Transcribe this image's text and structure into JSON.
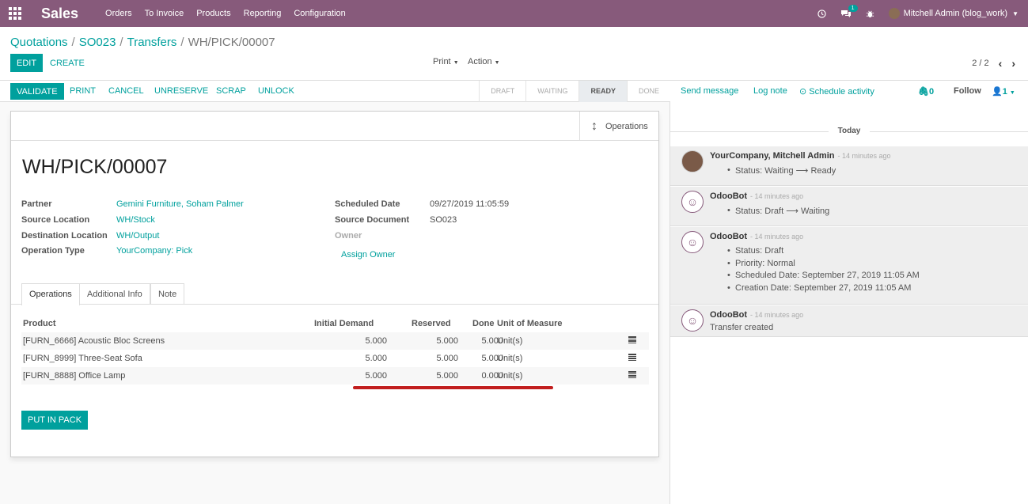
{
  "topnav": {
    "brand": "Sales",
    "menu": [
      "Orders",
      "To Invoice",
      "Products",
      "Reporting",
      "Configuration"
    ],
    "messages_count": "1",
    "user_name": "Mitchell Admin (blog_work)"
  },
  "control_panel": {
    "breadcrumbs": [
      "Quotations",
      "SO023",
      "Transfers"
    ],
    "breadcrumb_current": "WH/PICK/00007",
    "edit_label": "EDIT",
    "create_label": "CREATE",
    "print_label": "Print",
    "action_label": "Action",
    "pager": "2 / 2"
  },
  "statusbar": {
    "buttons": [
      "VALIDATE",
      "PRINT",
      "CANCEL",
      "UNRESERVE",
      "SCRAP",
      "UNLOCK"
    ],
    "steps": [
      "DRAFT",
      "WAITING",
      "READY",
      "DONE"
    ],
    "active_step": "READY"
  },
  "form": {
    "smart_button": "Operations",
    "title": "WH/PICK/00007",
    "left_fields": [
      {
        "label": "Partner",
        "value": "Gemini Furniture, Soham Palmer"
      },
      {
        "label": "Source Location",
        "value": "WH/Stock"
      },
      {
        "label": "Destination Location",
        "value": "WH/Output"
      },
      {
        "label": "Operation Type",
        "value": "YourCompany: Pick"
      }
    ],
    "right_fields": [
      {
        "label": "Scheduled Date",
        "value": "09/27/2019 11:05:59"
      },
      {
        "label": "Source Document",
        "value": "SO023"
      },
      {
        "label": "Owner",
        "value": ""
      }
    ],
    "assign_owner": "Assign Owner",
    "tabs": [
      "Operations",
      "Additional Info",
      "Note"
    ],
    "table": {
      "headers": [
        "Product",
        "Initial Demand",
        "Reserved",
        "Done",
        "Unit of Measure"
      ],
      "rows": [
        [
          "[FURN_6666] Acoustic Bloc Screens",
          "5.000",
          "5.000",
          "5.000",
          "Unit(s)"
        ],
        [
          "[FURN_8999] Three-Seat Sofa",
          "5.000",
          "5.000",
          "5.000",
          "Unit(s)"
        ],
        [
          "[FURN_8888] Office Lamp",
          "5.000",
          "5.000",
          "0.000",
          "Unit(s)"
        ]
      ]
    },
    "put_in_pack": "PUT IN PACK"
  },
  "chatter": {
    "send_message": "Send message",
    "log_note": "Log note",
    "schedule_activity": "Schedule activity",
    "attachments": "0",
    "follow": "Follow",
    "followers": "1",
    "today": "Today",
    "messages": [
      {
        "author": "YourCompany, Mitchell Admin",
        "time": "- 14 minutes ago",
        "lines": [
          "Status: Waiting ⟶ Ready"
        ]
      },
      {
        "author": "OdooBot",
        "time": "- 14 minutes ago",
        "lines": [
          "Status: Draft ⟶ Waiting"
        ]
      },
      {
        "author": "OdooBot",
        "time": "- 14 minutes ago",
        "lines": [
          "Status: Draft",
          "Priority: Normal",
          "Scheduled Date: September 27, 2019 11:05 AM",
          "Creation Date: September 27, 2019 11:05 AM"
        ]
      },
      {
        "author": "OdooBot",
        "time": "- 14 minutes ago",
        "plain": "Transfer created"
      }
    ]
  },
  "colors": {
    "brand": "#875a7b",
    "accent": "#00a09d",
    "annotation": "#c21e1e"
  }
}
